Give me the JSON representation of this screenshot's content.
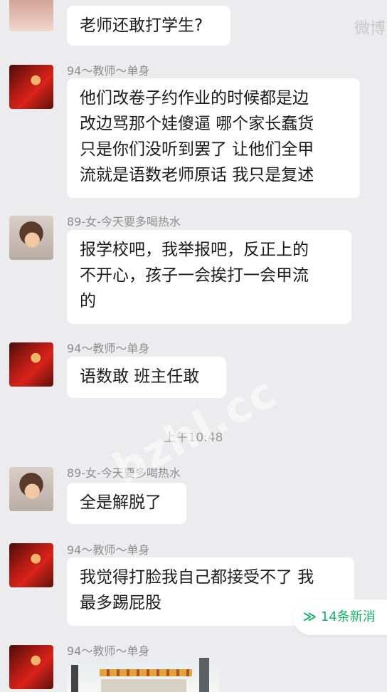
{
  "watermark": "bzhl.cc",
  "corner_mark": "微博",
  "timestamp": "上午10:48",
  "new_messages": {
    "icon": "double-chevron-down-icon",
    "glyph": "≫",
    "label": "14条新消"
  },
  "messages": [
    {
      "sender": "",
      "lines": [
        "老师还敢打学生?"
      ]
    },
    {
      "sender": "94～教师～单身",
      "lines": [
        "他们改卷子约作业的时候都是边",
        "改边骂那个娃傻逼 哪个家长蠢货",
        "只是你们没听到罢了 让他们全甲",
        "流就是语数老师原话 我只是复述"
      ]
    },
    {
      "sender": "89-女-今天要多喝热水",
      "lines": [
        "报学校吧，我举报吧，反正上的",
        "不开心，孩子一会挨打一会甲流",
        "的"
      ]
    },
    {
      "sender": "94～教师～单身",
      "lines": [
        "语数敢 班主任敢"
      ]
    },
    {
      "sender": "89-女-今天要多喝热水",
      "lines": [
        "全是解脱了"
      ]
    },
    {
      "sender": "94～教师～单身",
      "lines": [
        "我觉得打脸我自己都接受不了 我",
        "最多踢屁股"
      ]
    },
    {
      "sender": "94～教师～单身",
      "lines": []
    }
  ]
}
